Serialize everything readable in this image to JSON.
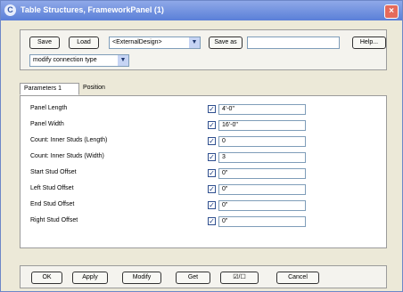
{
  "window": {
    "title": "Table Structures, FrameworkPanel (1)",
    "icon": "app-icon",
    "close": "×"
  },
  "toolbar": {
    "save": "Save",
    "load": "Load",
    "design_select": "<ExternalDesign>",
    "save_as": "Save as",
    "save_as_value": "",
    "help": "Help...",
    "mode_select": "modify connection type"
  },
  "tabs": [
    {
      "label": "Parameters 1"
    },
    {
      "label": "Position"
    }
  ],
  "parameters": [
    {
      "label": "Panel Length",
      "checked": true,
      "value": "4'-0\""
    },
    {
      "label": "Panel Width",
      "checked": true,
      "value": "16'-0\""
    },
    {
      "label": "Count: Inner Studs (Length)",
      "checked": true,
      "value": "0"
    },
    {
      "label": "Count: Inner Studs (Width)",
      "checked": true,
      "value": "3"
    },
    {
      "label": "Start Stud Offset",
      "checked": true,
      "value": "0\""
    },
    {
      "label": "Left Stud Offset",
      "checked": true,
      "value": "0\""
    },
    {
      "label": "End Stud Offset",
      "checked": true,
      "value": "0\""
    },
    {
      "label": "Right Stud Offset",
      "checked": true,
      "value": "0\""
    }
  ],
  "footer": {
    "ok": "OK",
    "apply": "Apply",
    "modify": "Modify",
    "get": "Get",
    "toggle": "☑/☐",
    "cancel": "Cancel"
  },
  "colors": {
    "title_bar": "#5a7fd8",
    "close_button": "#e56a5b",
    "window_background": "#ece9d8"
  }
}
